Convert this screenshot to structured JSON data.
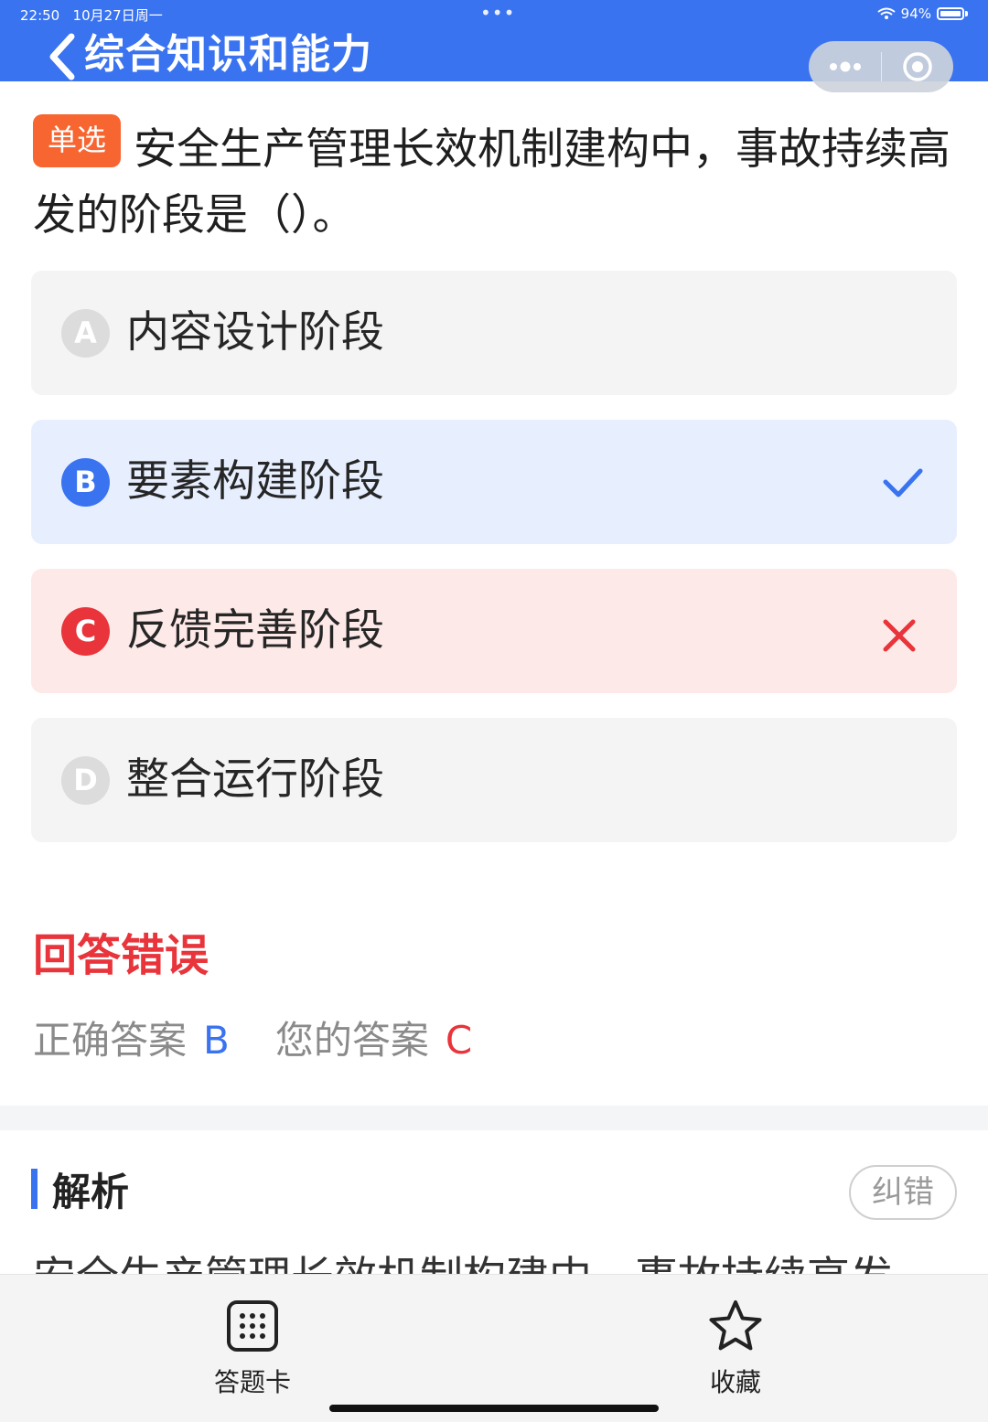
{
  "status_bar": {
    "time": "22:50",
    "date": "10月27日周一",
    "center_dots": "•••",
    "battery": "94%"
  },
  "header": {
    "title": "综合知识和能力",
    "accent_color": "#3a73f0"
  },
  "question": {
    "type_tag": "单选",
    "text": "安全生产管理长效机制建构中，事故持续高发的阶段是（）。"
  },
  "options": [
    {
      "letter": "A",
      "text": "内容设计阶段",
      "state": "neutral"
    },
    {
      "letter": "B",
      "text": "要素构建阶段",
      "state": "correct",
      "mark_icon": "check-icon"
    },
    {
      "letter": "C",
      "text": "反馈完善阶段",
      "state": "wrong",
      "mark_icon": "cross-icon"
    },
    {
      "letter": "D",
      "text": "整合运行阶段",
      "state": "neutral"
    }
  ],
  "result": {
    "title": "回答错误",
    "correct_label": "正确答案",
    "correct_value": "B",
    "mine_label": "您的答案",
    "mine_value": "C",
    "error_color": "#e8343a"
  },
  "analysis": {
    "title": "解析",
    "report_button": "纠错",
    "text": "安全生产管理长效机制构建中，事故持续高发"
  },
  "bottom_bar": {
    "answer_card_label": "答题卡",
    "favorite_label": "收藏"
  }
}
